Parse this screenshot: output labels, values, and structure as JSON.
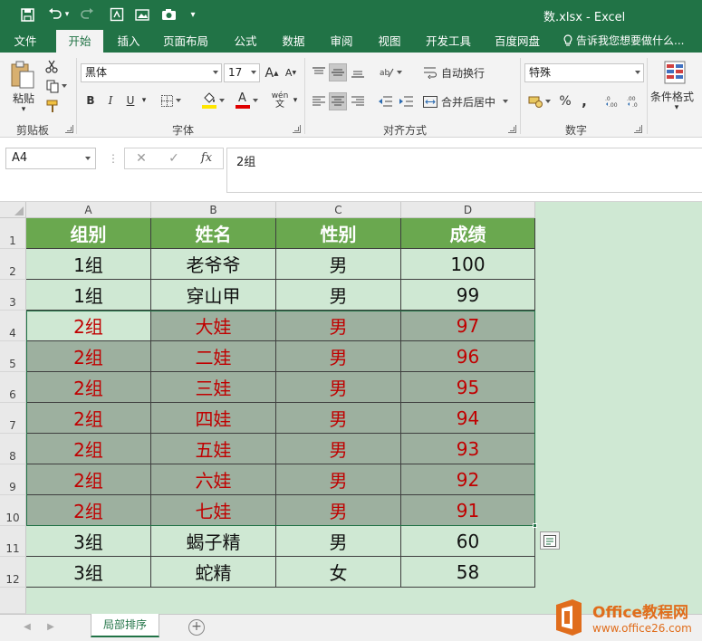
{
  "title_bar": {
    "title": "数.xlsx - Excel"
  },
  "ribbon_tabs": [
    {
      "label": "文件"
    },
    {
      "label": "开始"
    },
    {
      "label": "插入"
    },
    {
      "label": "页面布局"
    },
    {
      "label": "公式"
    },
    {
      "label": "数据"
    },
    {
      "label": "审阅"
    },
    {
      "label": "视图"
    },
    {
      "label": "开发工具"
    },
    {
      "label": "百度网盘"
    }
  ],
  "tell_me": "告诉我您想要做什么...",
  "ribbon": {
    "clipboard": {
      "paste_label": "粘贴",
      "group_label": "剪贴板"
    },
    "font": {
      "name": "黑体",
      "size": "17",
      "grow": "A",
      "shrink": "A",
      "bold": "B",
      "italic": "I",
      "underline": "U",
      "font_color_letter": "A",
      "fill_color": "#ffe600",
      "font_color": "#e00000",
      "phonetic": "wén",
      "group_label": "字体"
    },
    "alignment": {
      "wrap_label": "自动换行",
      "merge_label": "合并后居中",
      "group_label": "对齐方式"
    },
    "number": {
      "format": "特殊",
      "percent": "%",
      "comma": ",",
      "group_label": "数字"
    },
    "styles": {
      "conditional_label": "条件格式"
    }
  },
  "formula_bar": {
    "name_box": "A4",
    "cancel": "✕",
    "enter": "✓",
    "fx": "fx",
    "value": "2组"
  },
  "columns": [
    "A",
    "B",
    "C",
    "D"
  ],
  "rows": [
    "1",
    "2",
    "3",
    "4",
    "5",
    "6",
    "7",
    "8",
    "9",
    "10",
    "11",
    "12"
  ],
  "table": {
    "headers": [
      "组别",
      "姓名",
      "性别",
      "成绩"
    ],
    "data": [
      [
        "1组",
        "老爷爷",
        "男",
        "100"
      ],
      [
        "1组",
        "穿山甲",
        "男",
        "99"
      ],
      [
        "2组",
        "大娃",
        "男",
        "97"
      ],
      [
        "2组",
        "二娃",
        "男",
        "96"
      ],
      [
        "2组",
        "三娃",
        "男",
        "95"
      ],
      [
        "2组",
        "四娃",
        "男",
        "94"
      ],
      [
        "2组",
        "五娃",
        "男",
        "93"
      ],
      [
        "2组",
        "六娃",
        "男",
        "92"
      ],
      [
        "2组",
        "七娃",
        "男",
        "91"
      ],
      [
        "3组",
        "蝎子精",
        "男",
        "60"
      ],
      [
        "3组",
        "蛇精",
        "女",
        "58"
      ]
    ]
  },
  "sheet_tabs": [
    {
      "label": "局部排序"
    }
  ],
  "watermark": {
    "title": "Office教程网",
    "url": "www.office26.com"
  },
  "colors": {
    "excel_green": "#217346",
    "header_fill": "#6aa84f",
    "cell_fill": "#cfe8d3",
    "selection_fill": "#9db09f",
    "red_text": "#c00000",
    "watermark_orange": "#e06d1c"
  }
}
